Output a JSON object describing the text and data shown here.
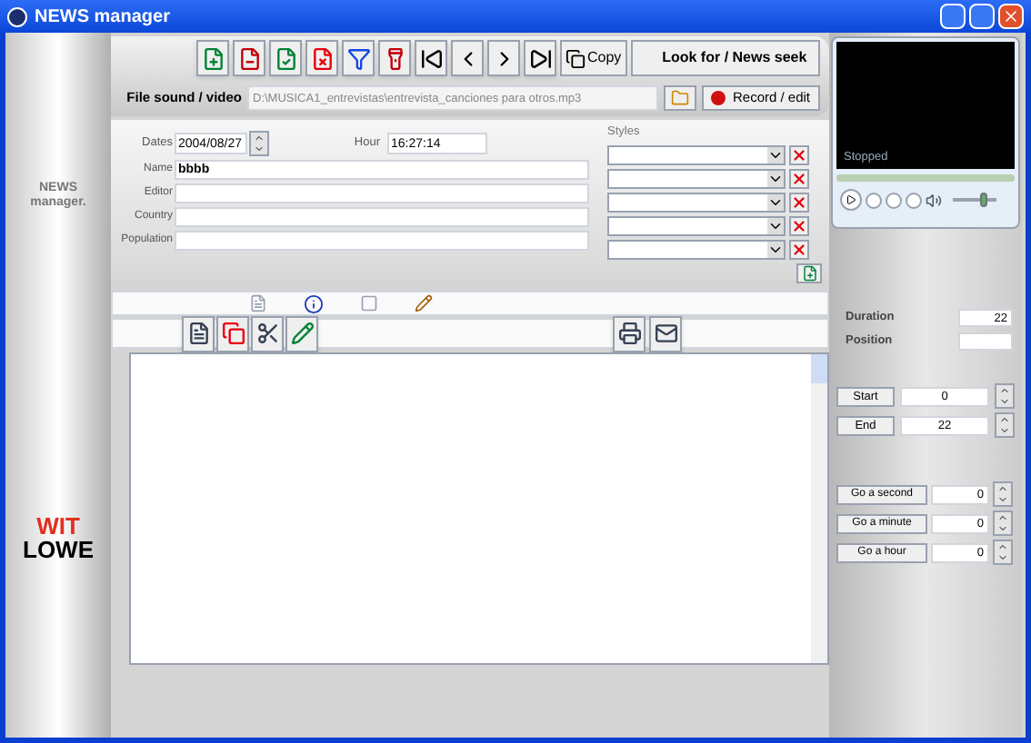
{
  "window": {
    "title": "NEWS manager"
  },
  "sidebar": {
    "title_lines": [
      "NEWS",
      "manager."
    ],
    "logo_top": "WIT",
    "logo_bottom": "LOWE"
  },
  "toolbar": {
    "copy_label": "Copy",
    "seek_label": "Look for / News seek"
  },
  "file": {
    "label": "File sound / video",
    "value": "D:\\MUSICA1_entrevistas\\entrevista_canciones para otros.mp3",
    "record_label": "Record / edit"
  },
  "form": {
    "dates_label": "Dates",
    "dates_value": "2004/08/27",
    "hour_label": "Hour",
    "hour_value": "16:27:14",
    "fields": [
      {
        "label": "Name",
        "value": "bbbb"
      },
      {
        "label": "Editor"
      },
      {
        "label": "Country"
      },
      {
        "label": "Population"
      }
    ]
  },
  "styles": {
    "label": "Styles"
  },
  "player": {
    "status": "Stopped",
    "volume": {
      "level": 0.7
    }
  },
  "timing": {
    "duration_label": "Duration",
    "duration_value": "22",
    "position_label": "Position",
    "start_label": "Start",
    "start_value": "0",
    "end_label": "End",
    "end_value": "22"
  },
  "goto": [
    {
      "label": "Go a second",
      "value": "0"
    },
    {
      "label": "Go a minute",
      "value": "0"
    },
    {
      "label": "Go a hour",
      "value": "0"
    }
  ]
}
